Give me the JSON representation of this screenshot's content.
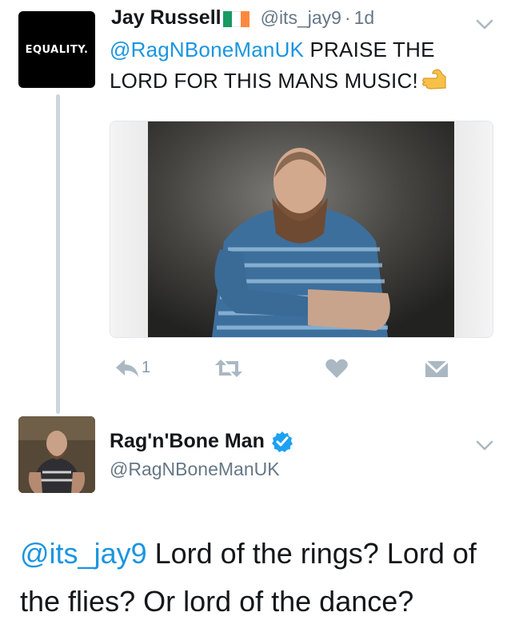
{
  "tweet1": {
    "avatar_text": "EQUALITY.",
    "name": "Jay Russell",
    "handle": "@its_jay9",
    "separator": "·",
    "time": "1d",
    "mention": "@RagNBoneManUK",
    "text": " PRAISE THE LORD FOR THIS MANS MUSIC!",
    "emoji": "pointing-hand-emoji",
    "reply_count": "1",
    "icons": [
      "reply-icon",
      "retweet-icon",
      "like-icon",
      "direct-message-icon",
      "chevron-down-icon"
    ]
  },
  "tweet2": {
    "name": "Rag'n'Bone Man",
    "handle": "@RagNBoneManUK",
    "mention": "@its_jay9",
    "text": " Lord of the rings? Lord of the flies? Or lord of the dance?",
    "verified_icon": "verified-badge-icon"
  },
  "colors": {
    "link": "#1b95e0",
    "secondary": "#657786",
    "action_icon": "#aab8c2",
    "thread_line": "#ccd6dd",
    "flag": [
      "#169b62",
      "#ffffff",
      "#ff883e"
    ]
  }
}
